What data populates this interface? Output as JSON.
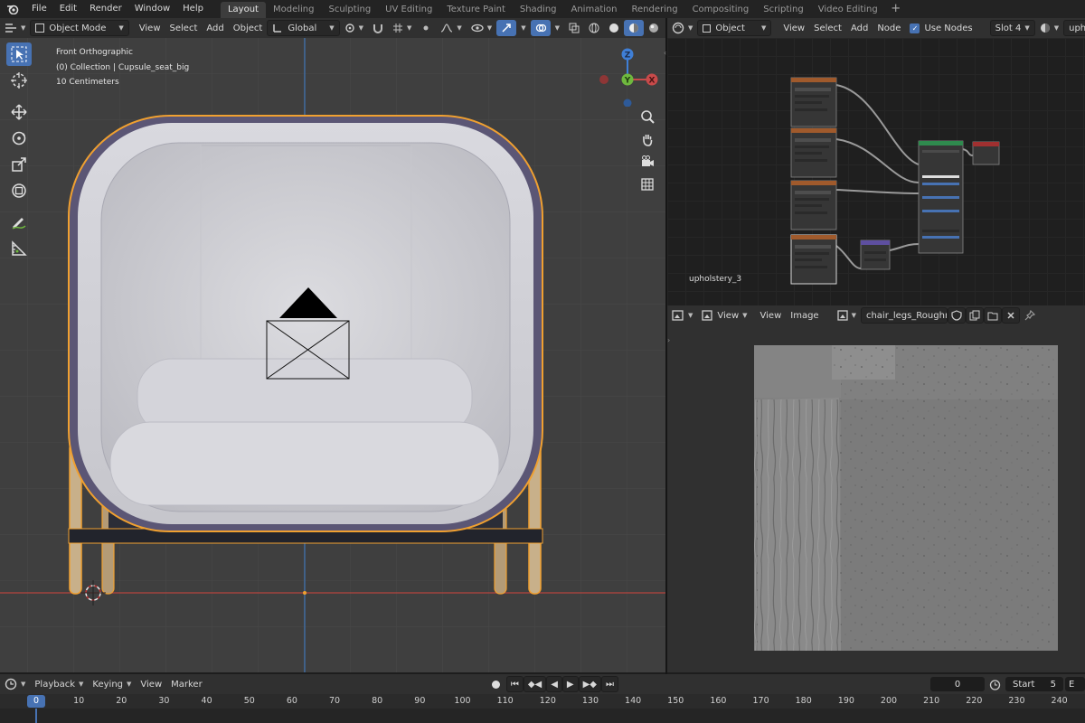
{
  "menu": [
    "File",
    "Edit",
    "Render",
    "Window",
    "Help"
  ],
  "workspaces": [
    {
      "label": "Layout",
      "active": true
    },
    {
      "label": "Modeling",
      "active": false
    },
    {
      "label": "Sculpting",
      "active": false
    },
    {
      "label": "UV Editing",
      "active": false
    },
    {
      "label": "Texture Paint",
      "active": false
    },
    {
      "label": "Shading",
      "active": false
    },
    {
      "label": "Animation",
      "active": false
    },
    {
      "label": "Rendering",
      "active": false
    },
    {
      "label": "Compositing",
      "active": false
    },
    {
      "label": "Scripting",
      "active": false
    },
    {
      "label": "Video Editing",
      "active": false
    }
  ],
  "workspace_add": "+",
  "viewport_header": {
    "mode": "Object Mode",
    "menus": [
      "View",
      "Select",
      "Add",
      "Object"
    ],
    "transform_orientation": "Global"
  },
  "viewport_info": {
    "view_name": "Front Orthographic",
    "collection": "(0) Collection | Cupsule_seat_big",
    "scale": "10 Centimeters"
  },
  "gizmo": {
    "z": "Z",
    "y": "Y",
    "x": "X"
  },
  "node_editor": {
    "object_type": "Object",
    "menus": [
      "View",
      "Select",
      "Add",
      "Node"
    ],
    "use_nodes_label": "Use Nodes",
    "use_nodes_checked": true,
    "slot": "Slot 4",
    "material_field": "uphol",
    "material_label": "upholstery_3"
  },
  "image_editor": {
    "view_mode": "View",
    "menus": [
      "View",
      "Image"
    ],
    "image_name": "chair_legs_Roughne..."
  },
  "timeline": {
    "menus": [
      "Playback",
      "Keying",
      "View",
      "Marker"
    ],
    "current_frame": "0",
    "start_label": "Start",
    "start_value": "5",
    "end_label": "E",
    "playhead": "0",
    "ticks": [
      "10",
      "20",
      "30",
      "40",
      "50",
      "60",
      "70",
      "80",
      "90",
      "100",
      "110",
      "120",
      "130",
      "140",
      "150",
      "160",
      "170",
      "180",
      "190",
      "200",
      "210",
      "220",
      "230",
      "240"
    ]
  },
  "colors": {
    "accent": "#4772b3",
    "selection_outline": "#f0a030",
    "axis_x": "#c84a4a",
    "axis_y": "#6fb83e",
    "axis_z": "#3f7fd6"
  }
}
